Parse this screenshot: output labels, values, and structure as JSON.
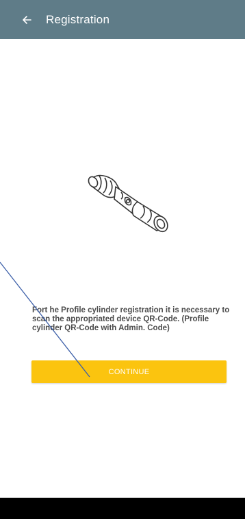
{
  "app_bar": {
    "title": "Registration",
    "back_icon": "arrow-left-icon",
    "background_color": "#5f7c88"
  },
  "illustration": {
    "icon": "profile-cylinder-icon"
  },
  "instructions": {
    "text": "Fort he Profile cylinder registration it is necessary to scan the appropriated device QR-Code. (Profile cylinder QR-Code with Admin. Code)"
  },
  "continue_button": {
    "label": "CONTINUE",
    "color": "#fbc40f"
  },
  "annotation": {
    "color": "#3b5ea8"
  }
}
